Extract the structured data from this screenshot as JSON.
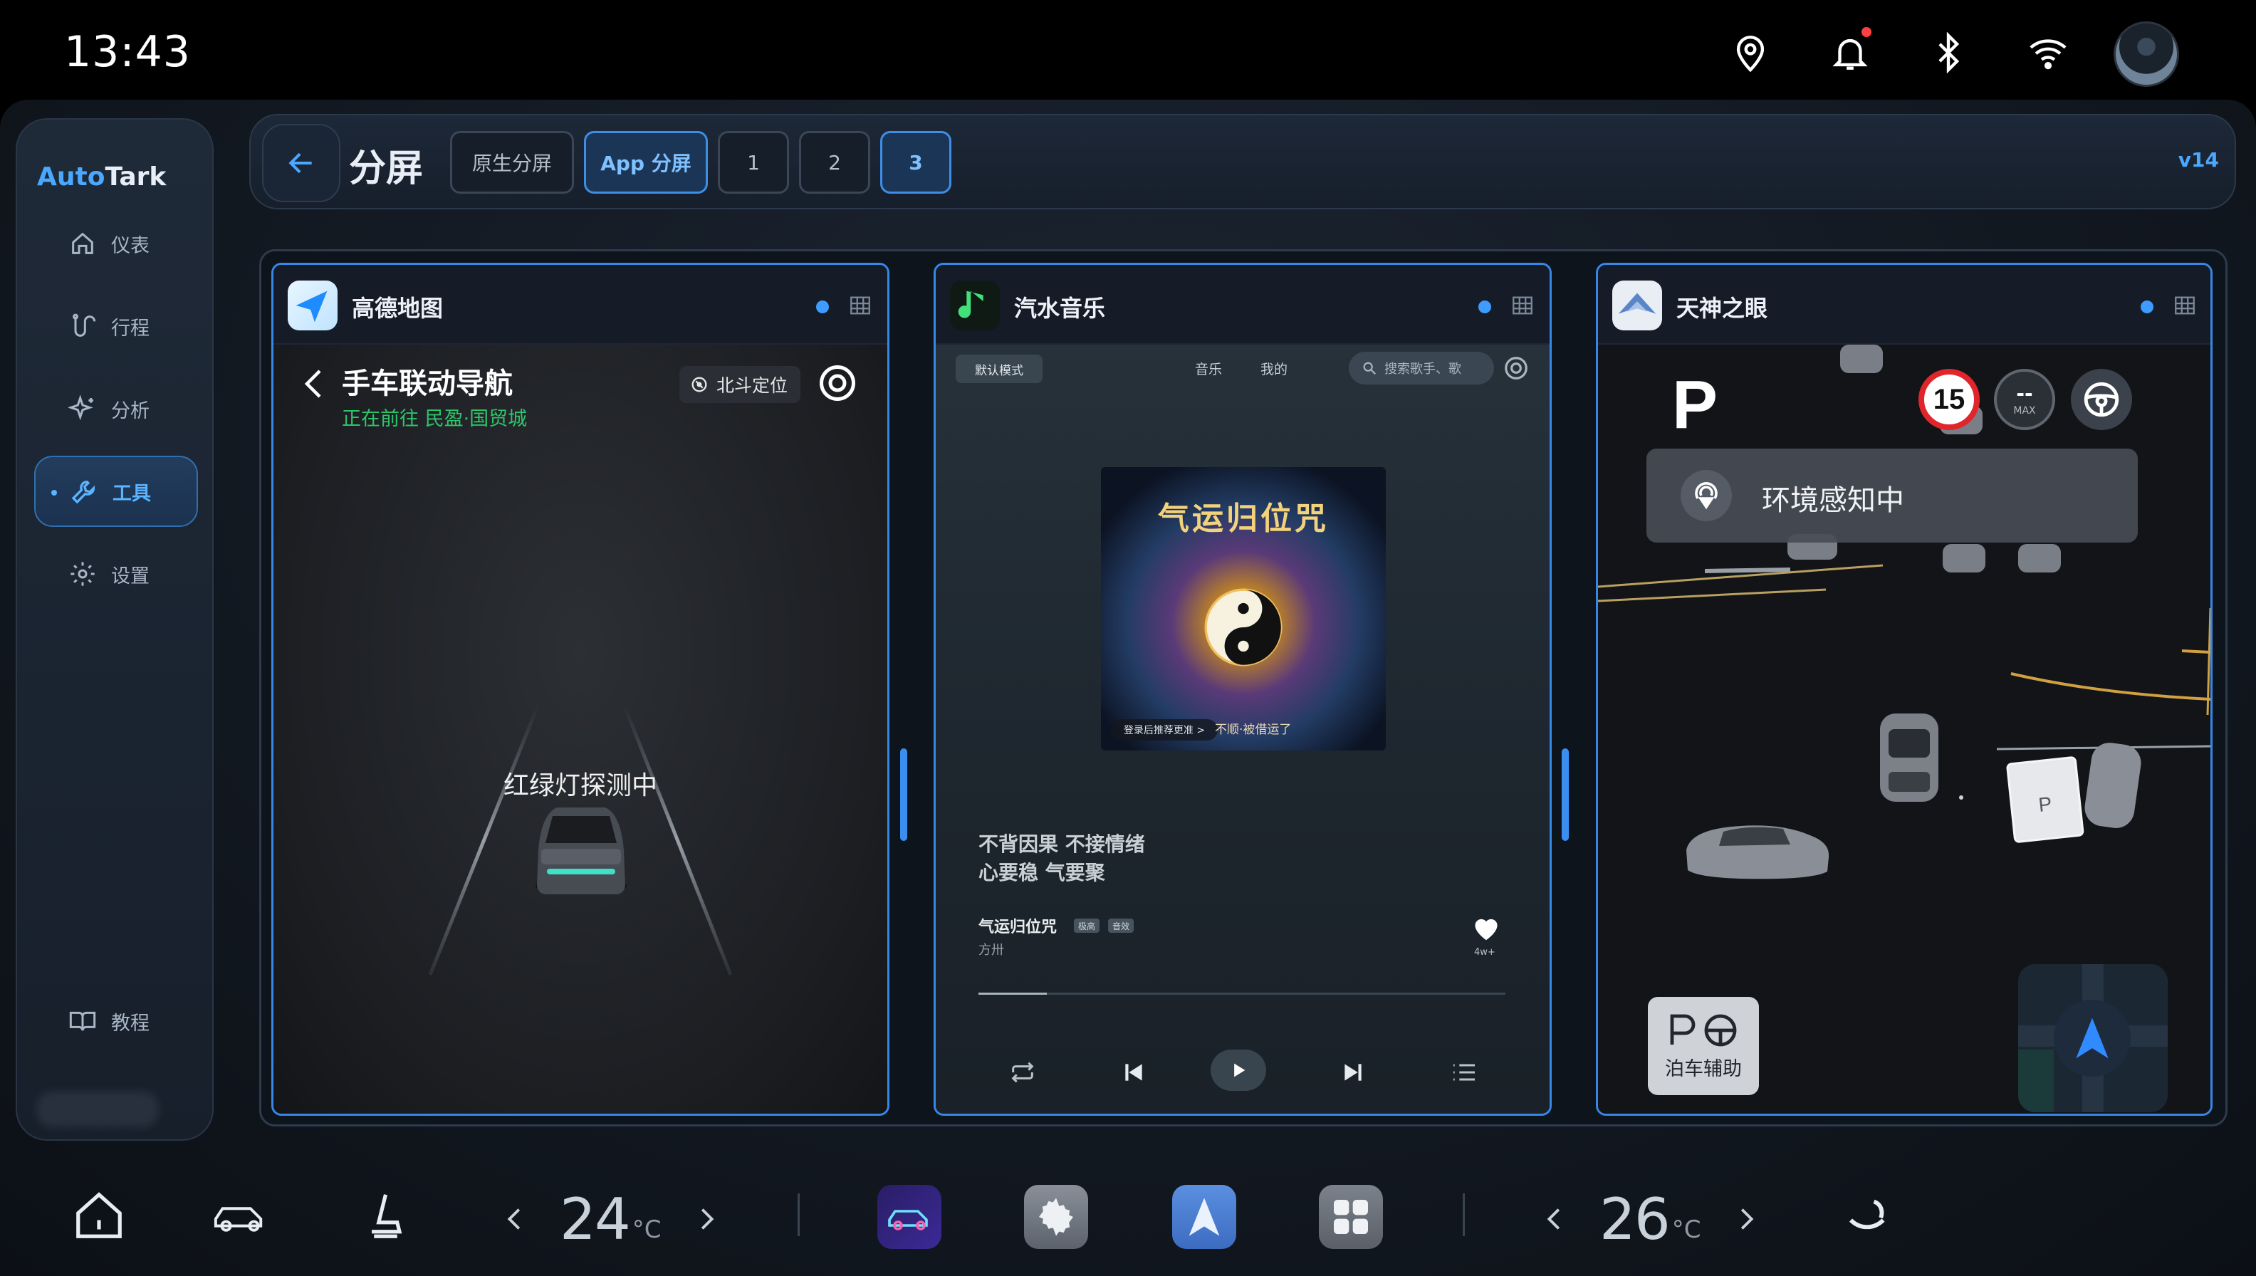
{
  "status": {
    "time": "13:43",
    "icons": [
      "location-pin-icon",
      "bell-icon",
      "bluetooth-icon",
      "wifi-icon"
    ],
    "notification_dot_color": "#ff4040"
  },
  "sidebar": {
    "brand_part1": "Auto",
    "brand_part2": "Tark",
    "items": [
      {
        "label": "仪表",
        "icon": "home-icon",
        "active": false
      },
      {
        "label": "行程",
        "icon": "route-icon",
        "active": false
      },
      {
        "label": "分析",
        "icon": "sparkle-icon",
        "active": false
      },
      {
        "label": "工具",
        "icon": "wrench-icon",
        "active": true
      },
      {
        "label": "设置",
        "icon": "gear-icon",
        "active": false
      }
    ],
    "tutorial_label": "教程"
  },
  "toolbar": {
    "title": "分屏",
    "buttons": [
      {
        "label": "原生分屏",
        "active": false
      },
      {
        "label": "App 分屏",
        "active": true
      },
      {
        "label": "1",
        "active": false
      },
      {
        "label": "2",
        "active": false
      },
      {
        "label": "3",
        "active": true
      }
    ],
    "version": "v14"
  },
  "panels": {
    "map": {
      "app_name": "高德地图",
      "nav_title": "手车联动导航",
      "nav_subtitle": "正在前往 民盈·国贸城",
      "beidou_label": "北斗定位",
      "traffic_light_text": "红绿灯探测中"
    },
    "music": {
      "app_name": "汽水音乐",
      "mode_label": "默认模式",
      "tabs": [
        "音乐",
        "我的"
      ],
      "search_placeholder": "搜索歌手、歌",
      "cover_title": "气运归位咒",
      "cover_login": "登录后推荐更准 >",
      "cover_caption": "不顺·被借运了",
      "lyric_line1": "不背因果 不接情绪",
      "lyric_line2": "心要稳 气要聚",
      "song_title": "气运归位咒",
      "tags": [
        "极高",
        "音效"
      ],
      "artist": "方卅",
      "likes": "4w+",
      "progress": 0.13
    },
    "parking": {
      "app_name": "天神之眼",
      "gear": "P",
      "speed_limit": "15",
      "max_speed_value": "--",
      "max_speed_label": "MAX",
      "env_text": "环境感知中",
      "park_assist_label": "泊车辅助"
    }
  },
  "dock": {
    "left_temp": "24",
    "right_temp": "26",
    "temp_unit": "°C"
  },
  "colors": {
    "accent": "#3e9bff",
    "panel_border": "#3787e8",
    "nav_green": "#2ec46a",
    "speed_red": "#e0262b"
  }
}
